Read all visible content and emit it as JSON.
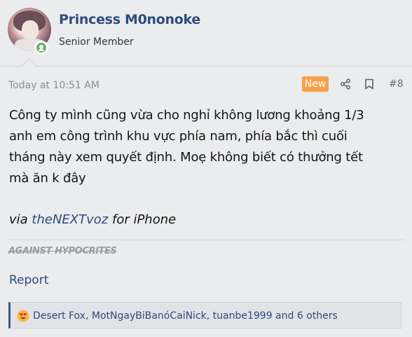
{
  "author": {
    "username": "Princess M0nonoke",
    "title": "Senior Member",
    "online": true
  },
  "post": {
    "timestamp": "Today at 10:51 AM",
    "new_badge": "New",
    "number": "#8",
    "body_lines": [
      "Công ty mình cũng vừa cho nghỉ không lương khoảng 1/3",
      "anh em công trình khu vực phía nam, phía bắc thì cuối",
      "tháng này xem quyết định. Moẹ không biết có thưởng tết",
      "mà ăn k đây"
    ],
    "via_prefix": "via",
    "via_app": "theNEXTvoz",
    "via_suffix": "for iPhone",
    "signature": "AGAINST HYPOCRITES",
    "report_label": "Report"
  },
  "reactions": {
    "summary": "Desert Fox, MotNgayBiBanóCaiNick, tuanbe1999 and 6 others",
    "emoji_icon": "heart-eyes-emoji-icon"
  },
  "icons": {
    "share": "share-icon",
    "bookmark": "bookmark-icon",
    "online": "online-status-icon"
  },
  "colors": {
    "link": "#2d4b7c",
    "new_badge": "#f7a04a",
    "online": "#5fb35f",
    "background": "#ebecee"
  }
}
